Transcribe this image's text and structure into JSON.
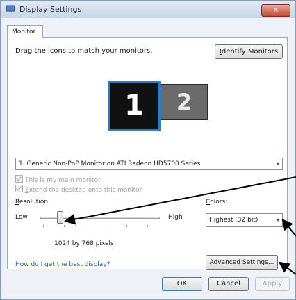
{
  "window": {
    "title": "Display Settings",
    "close_label": "✕"
  },
  "tab": {
    "label": "Monitor"
  },
  "instructions": "Drag the icons to match your monitors.",
  "identify_button": {
    "prefix": "",
    "accel": "I",
    "rest": "dentify Monitors"
  },
  "monitors": [
    {
      "label": "1"
    },
    {
      "label": "2"
    }
  ],
  "monitor_select": {
    "value": "1. Generic Non-PnP Monitor on ATI Radeon HD5700 Series",
    "arrow": "▾"
  },
  "checkboxes": [
    {
      "accel": "T",
      "rest": "his is my main monitor",
      "checked": true,
      "disabled": true
    },
    {
      "accel": "E",
      "rest": "xtend the desktop onto this monitor",
      "checked": true,
      "disabled": true
    }
  ],
  "resolution": {
    "label_accel": "R",
    "label_rest": "esolution:",
    "low": "Low",
    "high": "High",
    "value_text": "1024 by 768 pixels",
    "level": 0.15
  },
  "colors": {
    "label_accel": "C",
    "label_rest": "olors:",
    "value": "Highest (32 bit)",
    "arrow": "▾"
  },
  "help_link": "How do I get the best display?",
  "advanced_button": {
    "prefix": "Ad",
    "accel": "v",
    "rest": "anced Settings..."
  },
  "footer": {
    "ok": "OK",
    "cancel": "Cancel",
    "apply": "Apply"
  },
  "colors_accent": {
    "monitor_selected_border": "#2f79c9",
    "annotation_arrow": "#000000"
  }
}
